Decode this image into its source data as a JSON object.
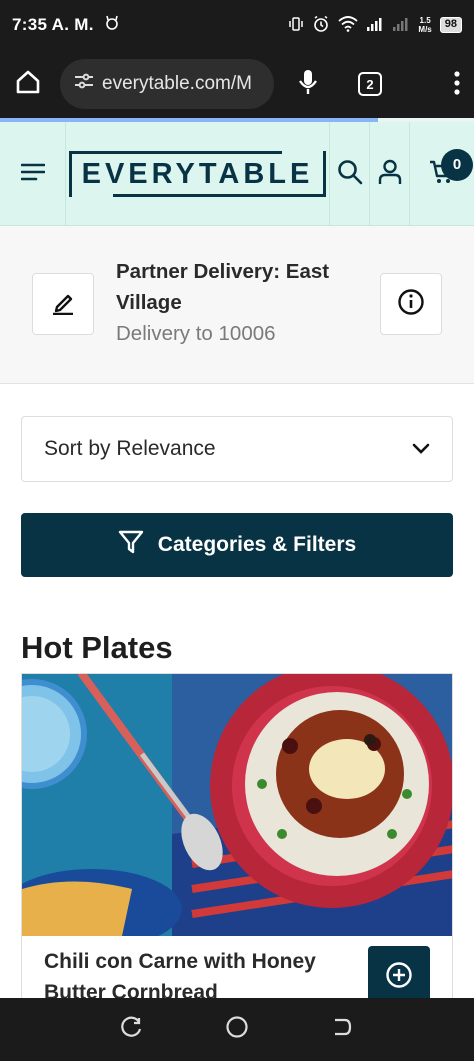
{
  "status_bar": {
    "time": "7:35 A. M.",
    "net_speed_value": "1.5",
    "net_speed_unit": "M/s",
    "battery": "98"
  },
  "browser": {
    "url": "everytable.com/M",
    "tab_count": "2"
  },
  "header": {
    "logo_text": "EVERYTABLE",
    "cart_count": "0"
  },
  "delivery": {
    "title": "Partner Delivery: East Village",
    "subtitle": "Delivery to 10006"
  },
  "sort": {
    "selected": "Sort by Relevance"
  },
  "filters": {
    "label": "Categories & Filters"
  },
  "section": {
    "title": "Hot Plates"
  },
  "products": [
    {
      "name": "Chili con Carne with Honey Butter Cornbread"
    }
  ],
  "icons": [
    "home-icon",
    "tune-icon",
    "mic-icon",
    "more-vert-icon",
    "hamburger-menu-icon",
    "search-icon",
    "user-icon",
    "cart-icon",
    "edit-icon",
    "info-icon",
    "chevron-down-icon",
    "filter-icon",
    "plus-circle-icon",
    "recents-icon",
    "home-circle-icon",
    "back-icon"
  ],
  "colors": {
    "brand_dark": "#083344",
    "header_bg": "#dcf5ef"
  }
}
